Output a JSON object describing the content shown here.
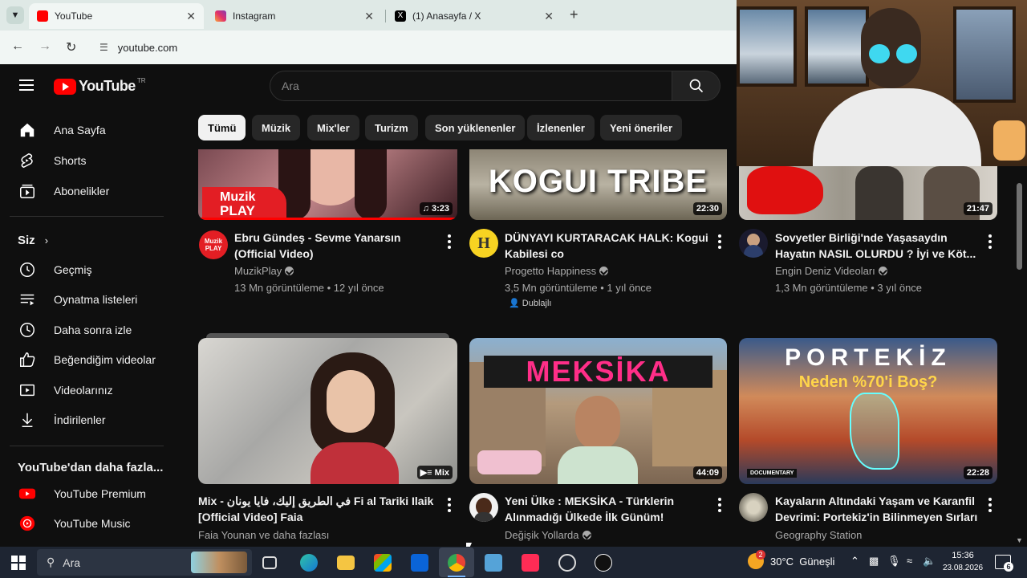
{
  "browser": {
    "tabs": [
      {
        "title": "YouTube",
        "active": true
      },
      {
        "title": "Instagram",
        "active": false
      },
      {
        "title": "(1) Anasayfa / X",
        "active": false
      }
    ],
    "url": "youtube.com"
  },
  "header": {
    "logo_text": "YouTube",
    "region": "TR",
    "search_placeholder": "Ara"
  },
  "sidebar": {
    "main": [
      {
        "label": "Ana Sayfa",
        "icon": "home-icon"
      },
      {
        "label": "Shorts",
        "icon": "shorts-icon"
      },
      {
        "label": "Abonelikler",
        "icon": "subscriptions-icon"
      }
    ],
    "you_heading": "Siz",
    "you_items": [
      {
        "label": "Geçmiş",
        "icon": "history-icon"
      },
      {
        "label": "Oynatma listeleri",
        "icon": "playlists-icon"
      },
      {
        "label": "Daha sonra izle",
        "icon": "watch-later-icon"
      },
      {
        "label": "Beğendiğim videolar",
        "icon": "like-icon"
      },
      {
        "label": "Videolarınız",
        "icon": "your-videos-icon"
      },
      {
        "label": "İndirilenler",
        "icon": "download-icon"
      }
    ],
    "more_heading": "YouTube'dan daha fazla...",
    "more_items": [
      {
        "label": "YouTube Premium",
        "icon": "youtube-premium-icon"
      },
      {
        "label": "YouTube Music",
        "icon": "youtube-music-icon"
      }
    ]
  },
  "chips": [
    "Tümü",
    "Müzik",
    "Mix'ler",
    "Turizm",
    "Son yüklenenler",
    "İzlenenler",
    "Yeni öneriler"
  ],
  "videos": [
    {
      "title_1": "Ebru Gündeş - Sevme Yanarsın",
      "title_2": "(Official Video)",
      "channel": "MuzikPlay",
      "meta": "13 Mn görüntüleme • 12 yıl önce",
      "duration": "3:23",
      "thumb_text_1": "Muzik",
      "thumb_text_2": "PLAY",
      "avatar_text": "Muzik PLAY"
    },
    {
      "title_1": "DÜNYAYI KURTARACAK HALK: Kogui",
      "title_2": "Kabilesi co",
      "channel": "Progetto Happiness",
      "meta": "3,5 Mn görüntüleme • 1 yıl önce",
      "badge": "Dublajlı",
      "duration": "22:30",
      "thumb_text": "KOGUI TRIBE",
      "avatar_text": "H"
    },
    {
      "title_1": "Sovyetler Birliği'nde Yaşasaydın",
      "title_2": "Hayatın NASIL OLURDU ? İyi ve Köt...",
      "channel": "Engin Deniz Videoları",
      "meta": "1,3 Mn görüntüleme • 3 yıl önce",
      "duration": "21:47"
    },
    {
      "title_1": "Mix - في الطريق إليك، فايا يونان Fi al Tariki Ilaik",
      "title_2": "[Official Video] Faia",
      "channel": "Faia Younan ve daha fazlası",
      "duration": "Mix"
    },
    {
      "title_1": "Yeni Ülke : MEKSİKA - Türklerin",
      "title_2": "Alınmadığı Ülkede İlk Günüm!",
      "channel": "Değişik Yollarda",
      "duration": "44:09",
      "thumb_text": "MEKSİKA"
    },
    {
      "title_1": "Kayaların Altındaki Yaşam ve Karanfil",
      "title_2": "Devrimi: Portekiz'in Bilinmeyen Sırları",
      "channel": "Geography Station",
      "duration": "22:28",
      "thumb_text_1": "PORTEKİZ",
      "thumb_text_2": "Neden %70'i Boş?",
      "thumb_badge": "DOCUMENTARY"
    }
  ],
  "taskbar": {
    "search_placeholder": "Ara",
    "weather": "30°C  Güneşli",
    "weather_badge": "2",
    "time": "15:36",
    "date": "23.08.2026",
    "notifications": "6"
  }
}
